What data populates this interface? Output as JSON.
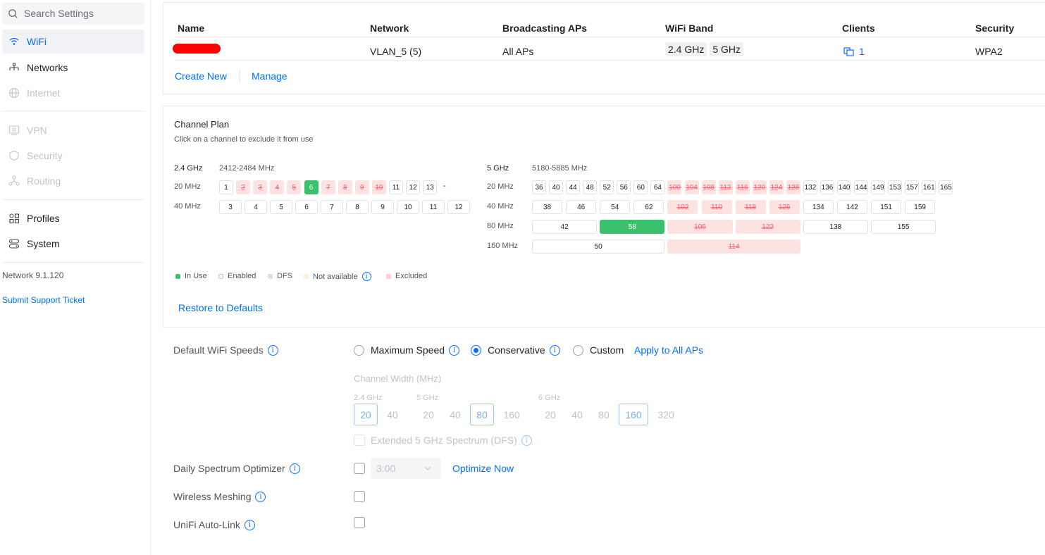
{
  "sidebar": {
    "search_placeholder": "Search Settings",
    "items": [
      {
        "label": "WiFi",
        "icon": "wifi-icon",
        "state": "active"
      },
      {
        "label": "Networks",
        "icon": "network-tree-icon",
        "state": "normal"
      },
      {
        "label": "Internet",
        "icon": "globe-icon",
        "state": "disabled"
      },
      {
        "label": "VPN",
        "icon": "vpn-icon",
        "state": "disabled"
      },
      {
        "label": "Security",
        "icon": "shield-icon",
        "state": "disabled"
      },
      {
        "label": "Routing",
        "icon": "routing-icon",
        "state": "disabled"
      },
      {
        "label": "Profiles",
        "icon": "profiles-icon",
        "state": "normal"
      },
      {
        "label": "System",
        "icon": "system-icon",
        "state": "normal"
      }
    ],
    "version": "Network 9.1.120",
    "support_link": "Submit Support Ticket"
  },
  "wifi_table": {
    "headers": [
      "Name",
      "Network",
      "Broadcasting APs",
      "WiFi Band",
      "Clients",
      "Security"
    ],
    "row": {
      "network": "VLAN_5 (5)",
      "aps": "All APs",
      "bands": [
        "2.4 GHz",
        "5 GHz"
      ],
      "clients": "1",
      "security": "WPA2"
    },
    "create_new": "Create New",
    "manage": "Manage"
  },
  "channel_plan": {
    "title": "Channel Plan",
    "subtitle": "Click on a channel to exclude it from use",
    "band24": {
      "label": "2.4 GHz",
      "range": "2412-2484 MHz",
      "w20_label": "20 MHz",
      "w40_label": "40 MHz",
      "w20": [
        {
          "c": "1",
          "s": "enabled"
        },
        {
          "c": "2",
          "s": "excluded"
        },
        {
          "c": "3",
          "s": "excluded"
        },
        {
          "c": "4",
          "s": "excluded"
        },
        {
          "c": "5",
          "s": "excluded"
        },
        {
          "c": "6",
          "s": "inuse"
        },
        {
          "c": "7",
          "s": "excluded"
        },
        {
          "c": "8",
          "s": "excluded"
        },
        {
          "c": "9",
          "s": "excluded"
        },
        {
          "c": "10",
          "s": "excluded"
        },
        {
          "c": "11",
          "s": "enabled"
        },
        {
          "c": "12",
          "s": "enabled"
        },
        {
          "c": "13",
          "s": "enabled"
        }
      ],
      "w20_trailing": "-",
      "w40": [
        "3",
        "4",
        "5",
        "6",
        "7",
        "8",
        "9",
        "10",
        "11",
        "12"
      ]
    },
    "band5": {
      "label": "5 GHz",
      "range": "5180-5885 MHz",
      "w20_label": "20 MHz",
      "w40_label": "40 MHz",
      "w80_label": "80 MHz",
      "w160_label": "160 MHz",
      "w20": [
        {
          "c": "36",
          "s": "enabled"
        },
        {
          "c": "40",
          "s": "enabled"
        },
        {
          "c": "44",
          "s": "enabled"
        },
        {
          "c": "48",
          "s": "enabled"
        },
        {
          "c": "52",
          "s": "enabled"
        },
        {
          "c": "56",
          "s": "enabled"
        },
        {
          "c": "60",
          "s": "enabled"
        },
        {
          "c": "64",
          "s": "enabled"
        },
        {
          "c": "100",
          "s": "excluded"
        },
        {
          "c": "104",
          "s": "excluded"
        },
        {
          "c": "108",
          "s": "excluded"
        },
        {
          "c": "112",
          "s": "excluded"
        },
        {
          "c": "116",
          "s": "excluded"
        },
        {
          "c": "120",
          "s": "excluded"
        },
        {
          "c": "124",
          "s": "excluded"
        },
        {
          "c": "128",
          "s": "excluded"
        },
        {
          "c": "132",
          "s": "enabled"
        },
        {
          "c": "136",
          "s": "enabled"
        },
        {
          "c": "140",
          "s": "enabled"
        },
        {
          "c": "144",
          "s": "enabled"
        },
        {
          "c": "149",
          "s": "enabled"
        },
        {
          "c": "153",
          "s": "enabled"
        },
        {
          "c": "157",
          "s": "enabled"
        },
        {
          "c": "161",
          "s": "enabled"
        },
        {
          "c": "165",
          "s": "enabled"
        }
      ],
      "w40": [
        {
          "c": "38",
          "s": "enabled"
        },
        {
          "c": "46",
          "s": "enabled"
        },
        {
          "c": "54",
          "s": "enabled"
        },
        {
          "c": "62",
          "s": "enabled"
        },
        {
          "c": "102",
          "s": "excluded"
        },
        {
          "c": "110",
          "s": "excluded"
        },
        {
          "c": "118",
          "s": "excluded"
        },
        {
          "c": "126",
          "s": "excluded"
        },
        {
          "c": "134",
          "s": "enabled"
        },
        {
          "c": "142",
          "s": "enabled"
        },
        {
          "c": "151",
          "s": "enabled"
        },
        {
          "c": "159",
          "s": "enabled"
        }
      ],
      "w80": [
        {
          "c": "42",
          "s": "enabled"
        },
        {
          "c": "58",
          "s": "inuse"
        },
        {
          "c": "106",
          "s": "excluded"
        },
        {
          "c": "122",
          "s": "excluded"
        },
        {
          "c": "138",
          "s": "enabled"
        },
        {
          "c": "155",
          "s": "enabled"
        }
      ],
      "w160": [
        {
          "c": "50",
          "s": "enabled"
        },
        {
          "c": "114",
          "s": "excluded"
        }
      ]
    },
    "legend": {
      "in_use": "In Use",
      "enabled": "Enabled",
      "dfs": "DFS",
      "not_available": "Not available",
      "excluded": "Excluded"
    },
    "restore": "Restore to Defaults"
  },
  "settings": {
    "wifi_speeds_label": "Default WiFi Speeds",
    "speed_options": [
      "Maximum Speed",
      "Conservative",
      "Custom"
    ],
    "speed_selected": "Conservative",
    "apply_all": "Apply to All APs",
    "channel_width_label": "Channel Width (MHz)",
    "cw_groups": [
      {
        "label": "2.4 GHz",
        "values": [
          "20",
          "40"
        ],
        "selected": "20"
      },
      {
        "label": "5 GHz",
        "values": [
          "20",
          "40",
          "80",
          "160"
        ],
        "selected": "80"
      },
      {
        "label": "6 GHz",
        "values": [
          "20",
          "40",
          "80",
          "160",
          "320"
        ],
        "selected": "160"
      }
    ],
    "extended_dfs": "Extended 5 GHz Spectrum (DFS)",
    "spectrum_label": "Daily Spectrum Optimizer",
    "spectrum_time": "3:00",
    "optimize_now": "Optimize Now",
    "meshing_label": "Wireless Meshing",
    "autolink_label": "UniFi Auto-Link"
  },
  "colors": {
    "accent": "#006fff",
    "in_use": "#3ac16c",
    "excluded_bg": "#fde2e2",
    "excluded_text": "#e86c6c"
  }
}
